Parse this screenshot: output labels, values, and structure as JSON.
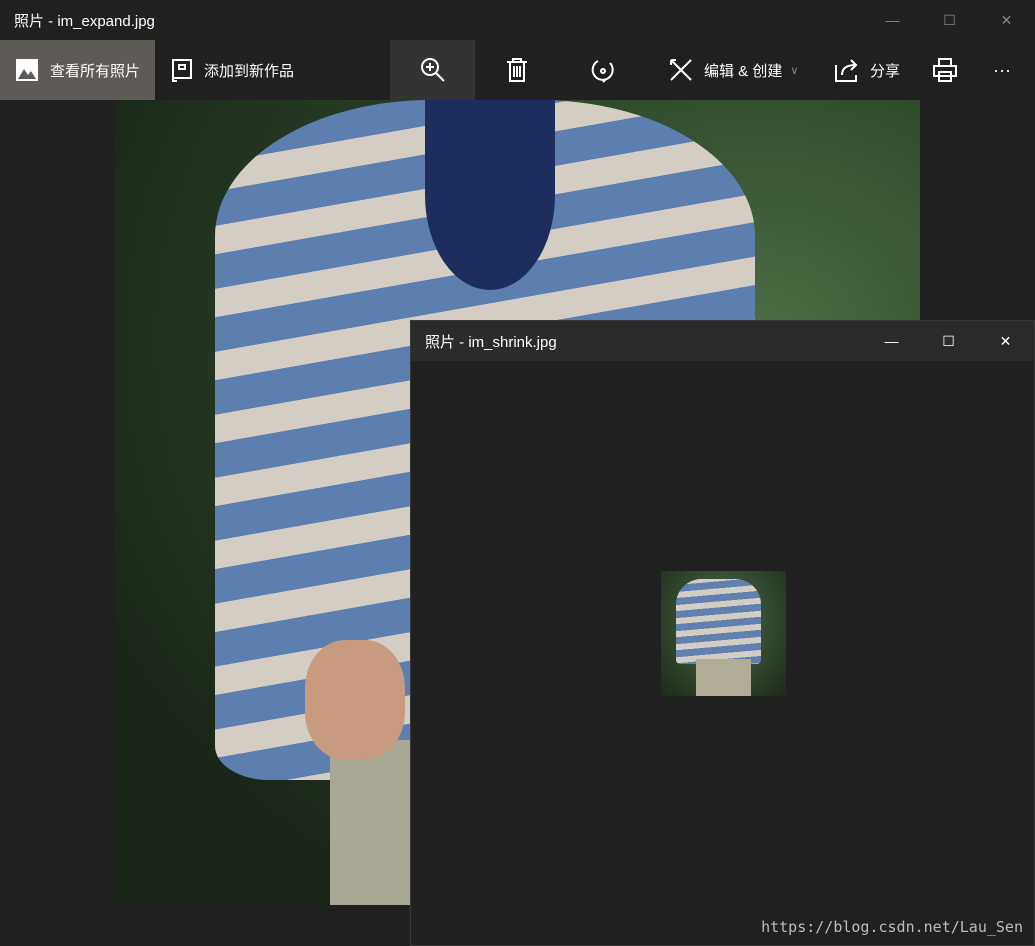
{
  "main_window": {
    "title": "照片 - im_expand.jpg"
  },
  "toolbar": {
    "view_all": "查看所有照片",
    "add_to_creation": "添加到新作品",
    "edit_create": "编辑 & 创建",
    "share": "分享",
    "more": "···"
  },
  "window_controls": {
    "minimize": "—",
    "maximize": "☐",
    "close": "✕"
  },
  "second_window": {
    "title": "照片 - im_shrink.jpg"
  },
  "watermark": "https://blog.csdn.net/Lau_Sen"
}
